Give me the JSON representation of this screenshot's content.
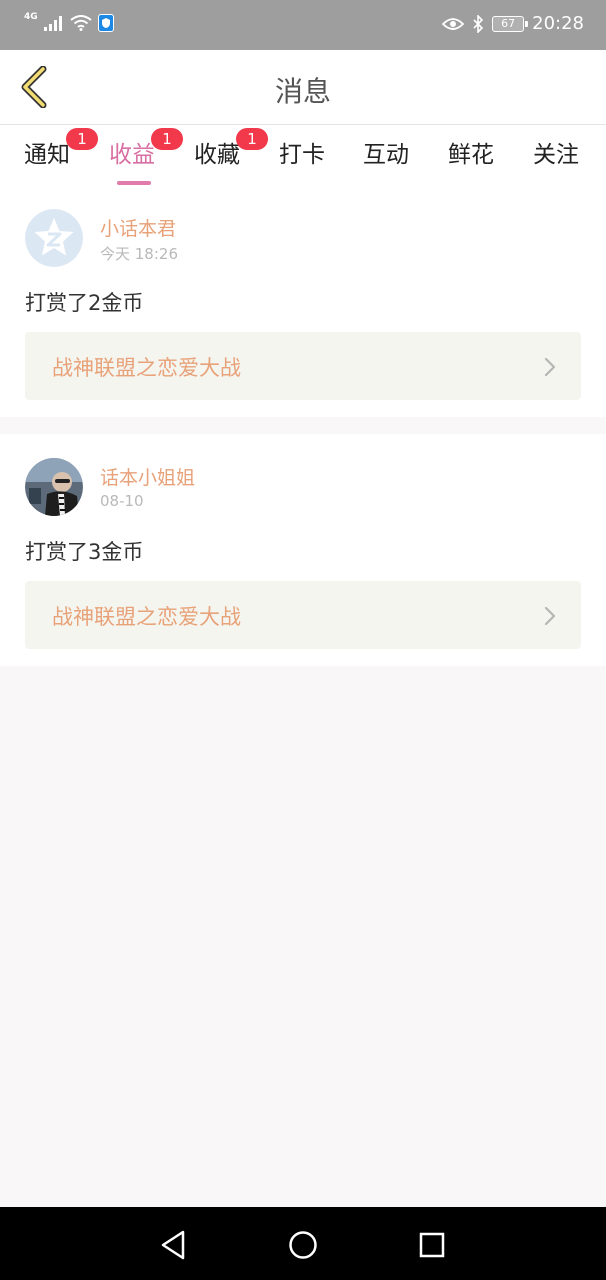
{
  "status_bar": {
    "network_label": "4G",
    "battery": "67",
    "time": "20:28",
    "icons": [
      "signal-icon",
      "wifi-icon",
      "shield-icon",
      "eye-icon",
      "bluetooth-icon",
      "battery-icon"
    ]
  },
  "header": {
    "title": "消息",
    "back_icon": "chevron-left-icon"
  },
  "tabs": [
    {
      "label": "通知",
      "badge": "1"
    },
    {
      "label": "收益",
      "badge": "1",
      "active": true
    },
    {
      "label": "收藏",
      "badge": "1"
    },
    {
      "label": "打卡"
    },
    {
      "label": "互动"
    },
    {
      "label": "鲜花"
    },
    {
      "label": "关注"
    }
  ],
  "messages": [
    {
      "user": "小话本君",
      "time": "今天 18:26",
      "text": "打赏了2金币",
      "book": "战神联盟之恋爱大战"
    },
    {
      "user": "话本小姐姐",
      "time": "08-10",
      "text": "打赏了3金币",
      "book": "战神联盟之恋爱大战"
    }
  ],
  "colors": {
    "accent": "#d86fa2",
    "badge": "#f2394b",
    "username": "#e8a27a",
    "status_bar": "#9e9e9e"
  },
  "nav": {
    "icons": [
      "back-triangle-icon",
      "home-circle-icon",
      "recents-square-icon"
    ]
  }
}
